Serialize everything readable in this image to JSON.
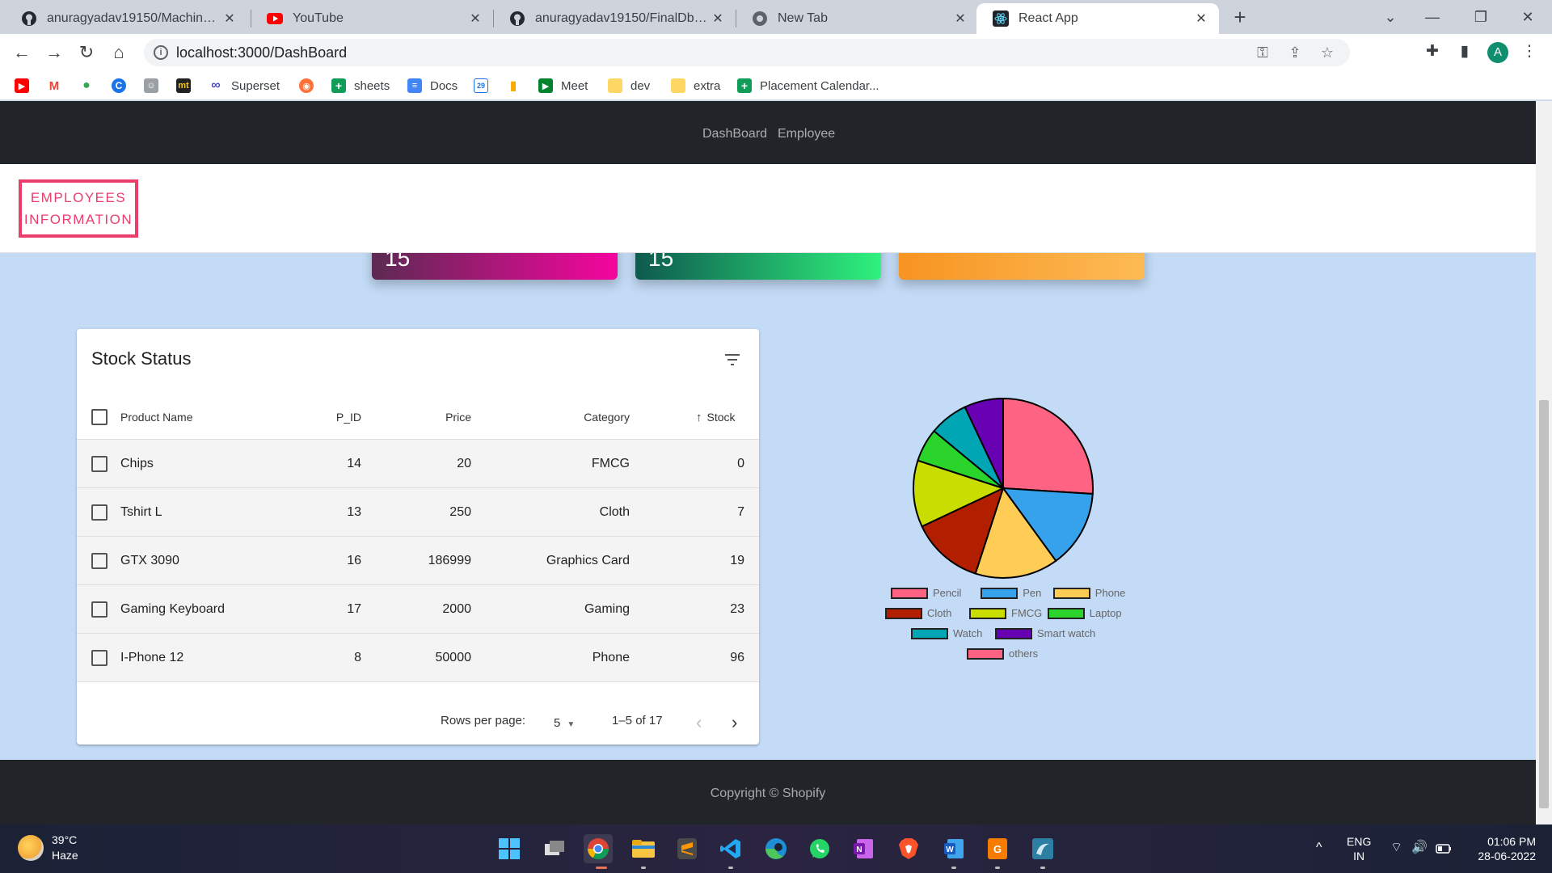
{
  "browser": {
    "tabs": [
      {
        "label": "anuragyadav19150/Machine_Lea",
        "icon": "github-icon"
      },
      {
        "label": "YouTube",
        "icon": "youtube-icon"
      },
      {
        "label": "anuragyadav19150/FinalDbmsPro",
        "icon": "github-icon"
      },
      {
        "label": "New Tab",
        "icon": "chrome-icon"
      },
      {
        "label": "React App",
        "icon": "react-icon"
      }
    ],
    "url": "localhost:3000/DashBoard",
    "avatar_letter": "A",
    "bookmarks": [
      {
        "label": "Superset"
      },
      {
        "label": "sheets"
      },
      {
        "label": "Docs"
      },
      {
        "label": "Meet"
      },
      {
        "label": "dev"
      },
      {
        "label": "extra"
      },
      {
        "label": "Placement Calendar..."
      }
    ],
    "calendar_badge": "29",
    "mt_badge": "mt"
  },
  "navbar": {
    "links": [
      "DashBoard",
      "Employee"
    ]
  },
  "subheader": {
    "employees_button": "EMPLOYEES INFORMATION"
  },
  "cards": [
    {
      "value": "15",
      "colors": [
        "#5c2a52",
        "#f5059e"
      ]
    },
    {
      "value": "15",
      "colors": [
        "#0e5a4e",
        "#2ff27d"
      ]
    },
    {
      "value": "",
      "colors": [
        "#f79422",
        "#fdbb55"
      ]
    }
  ],
  "stock_table": {
    "title": "Stock Status",
    "columns": [
      "Product Name",
      "P_ID",
      "Price",
      "Category",
      "Stock"
    ],
    "rows": [
      {
        "name": "Chips",
        "pid": "14",
        "price": "20",
        "category": "FMCG",
        "stock": "0"
      },
      {
        "name": "Tshirt L",
        "pid": "13",
        "price": "250",
        "category": "Cloth",
        "stock": "7"
      },
      {
        "name": "GTX 3090",
        "pid": "16",
        "price": "186999",
        "category": "Graphics Card",
        "stock": "19"
      },
      {
        "name": "Gaming Keyboard",
        "pid": "17",
        "price": "2000",
        "category": "Gaming",
        "stock": "23"
      },
      {
        "name": "I-Phone 12",
        "pid": "8",
        "price": "50000",
        "category": "Phone",
        "stock": "96"
      }
    ],
    "rows_per_page_label": "Rows per page:",
    "rows_per_page_value": "5",
    "range_label": "1–5 of 17"
  },
  "chart_data": {
    "type": "pie",
    "categories": [
      "Pencil",
      "Pen",
      "Phone",
      "Cloth",
      "FMCG",
      "Laptop",
      "Watch",
      "Smart watch",
      "others"
    ],
    "values": [
      26,
      14,
      15,
      13,
      12,
      6,
      7,
      7,
      0
    ],
    "colors": [
      "#ff6384",
      "#36a2eb",
      "#ffcd56",
      "#b21f00",
      "#c9de00",
      "#2bd42b",
      "#00a6b4",
      "#6800b4",
      "#ff6384"
    ],
    "title": "",
    "legend_position": "bottom"
  },
  "footer": {
    "copyright": "Copyright © Shopify"
  },
  "taskbar": {
    "temperature": "39°C",
    "weather": "Haze",
    "lang_top": "ENG",
    "lang_bottom": "IN",
    "time": "01:06 PM",
    "date": "28-06-2022"
  }
}
